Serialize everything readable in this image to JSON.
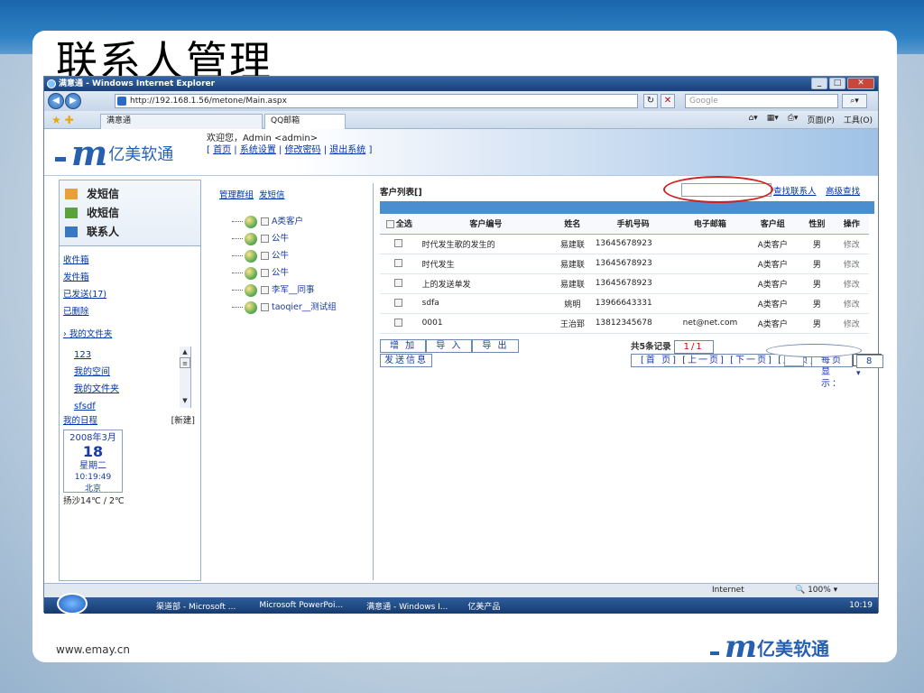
{
  "slide": {
    "title": "联系人管理",
    "footer_url": "www.emay.cn",
    "footer_logo_text": "亿美软通"
  },
  "browser": {
    "window_title": "满意通 - Windows Internet Explorer",
    "url": "http://192.168.1.56/metone/Main.aspx",
    "search_placeholder": "Google",
    "tabs": [
      "满意通",
      "QQ邮箱"
    ],
    "cmd_page": "页面(P)",
    "cmd_tools": "工具(O)",
    "status_zone": "Internet",
    "status_zoom": "100%"
  },
  "header": {
    "logo_text": "亿美软通",
    "welcome_line": "欢迎您，Admin <admin>",
    "links": [
      "首页",
      "系统设置",
      "修改密码",
      "退出系统"
    ]
  },
  "sidebar": {
    "top_items": [
      "发短信",
      "收短信",
      "联系人"
    ],
    "links": [
      "收件箱",
      "发件箱",
      "已发送(17)",
      "已删除"
    ],
    "folder_title": "我的文件夹",
    "folders": [
      "123",
      "我的空间",
      "我的文件夹",
      "sfsdf"
    ],
    "schedule_label": "我的日程",
    "schedule_new": "[新建]",
    "calendar": {
      "year_month": "2008年3月",
      "day": "18",
      "weekday": "星期二",
      "time": "10:19:49",
      "city": "北京"
    },
    "weather": "扬沙14℃ / 2℃"
  },
  "tree": {
    "links": [
      "管理群组",
      "发短信"
    ],
    "nodes": [
      "A类客户",
      "公牛",
      "公牛",
      "公牛",
      "李军__同事",
      "taoqier__测试组"
    ]
  },
  "list": {
    "title": "客户列表[]",
    "search_btn": "查找联系人",
    "adv_search": "高级查找",
    "columns": [
      "全选",
      "客户编号",
      "姓名",
      "手机号码",
      "电子邮箱",
      "客户组",
      "性别",
      "操作"
    ],
    "rows": [
      [
        "时代发生歌的发生的",
        "易建联",
        "13645678923",
        "",
        "A类客户",
        "男",
        "修改"
      ],
      [
        "时代发生",
        "易建联",
        "13645678923",
        "",
        "A类客户",
        "男",
        "修改"
      ],
      [
        "上的发送单发",
        "易建联",
        "13645678923",
        "",
        "A类客户",
        "男",
        "修改"
      ],
      [
        "sdfa",
        "姚明",
        "13966643331",
        "",
        "A类客户",
        "男",
        "修改"
      ],
      [
        "0001",
        "王治郅",
        "13812345678",
        "net@net.com",
        "A类客户",
        "男",
        "修改"
      ]
    ],
    "buttons": [
      "增 加",
      "导 入",
      "导 出"
    ],
    "send_btn": "发送信息",
    "pager_total": "共5条记录",
    "pager_pages": "1/1",
    "pager_nav": "[首 页] [上一页] [下一页] [尾 页] 转到",
    "per_page_label": "每页显示：",
    "per_page_value": "8"
  },
  "taskbar": {
    "items": [
      "渠道部 - Microsoft ...",
      "Microsoft PowerPoi...",
      "满意通 - Windows I...",
      "亿美产品"
    ],
    "clock": "10:19"
  },
  "colors": {
    "accent": "#2860b0",
    "highlight_ellipse": "#d01f1f",
    "table_bar": "#4b8ed0"
  }
}
